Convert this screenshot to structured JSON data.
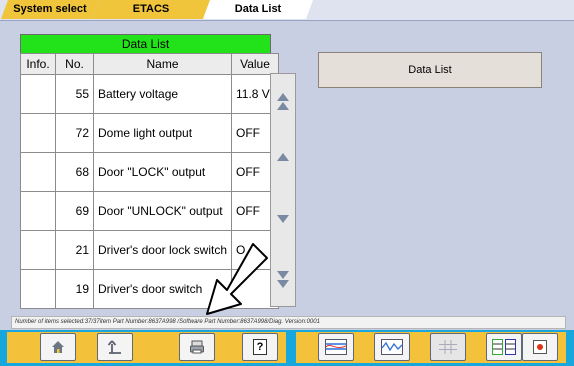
{
  "tabs": [
    "System select",
    "ETACS",
    "Data List"
  ],
  "table": {
    "title": "Data List",
    "headers": [
      "Info.",
      "No.",
      "Name",
      "Value"
    ],
    "rows": [
      {
        "info": "",
        "no": "55",
        "name": "Battery voltage",
        "value": "11.8 V"
      },
      {
        "info": "",
        "no": "72",
        "name": "Dome light output",
        "value": "OFF"
      },
      {
        "info": "",
        "no": "68",
        "name": "Door \"LOCK\" output",
        "value": "OFF"
      },
      {
        "info": "",
        "no": "69",
        "name": "Door \"UNLOCK\" output",
        "value": "OFF"
      },
      {
        "info": "",
        "no": "21",
        "name": "Driver's door lock switch",
        "value": "O"
      },
      {
        "info": "",
        "no": "19",
        "name": "Driver's door switch",
        "value": ""
      }
    ]
  },
  "side_button": {
    "label": "Data List"
  },
  "status_text": "Number of items selected:37/37item   Part Number:8637A998  /Software Part Number:8637A998/Diag. Version:0001",
  "toolbar": {
    "icons": [
      "home-icon",
      "back-icon",
      "print-icon",
      "help-icon",
      "graph-icon",
      "chart-icon",
      "table-icon",
      "split-icon",
      "record-icon"
    ],
    "help_label": "?"
  },
  "colors": {
    "accent_bar": "#17a7dc",
    "group_yellow": "#f3c23a",
    "title_green": "#22e31a"
  }
}
